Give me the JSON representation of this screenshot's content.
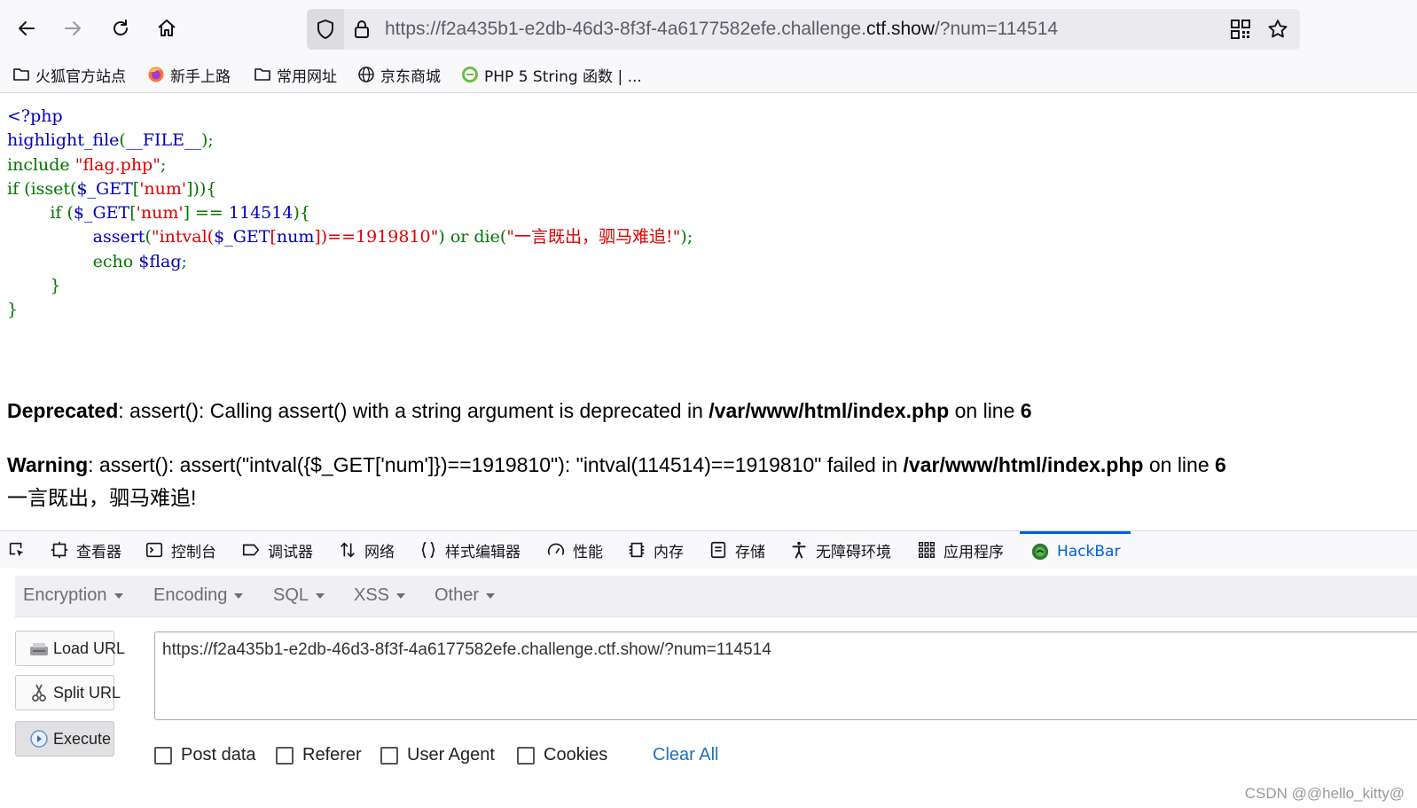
{
  "browser": {
    "url_prefix": "https://f2a435b1-e2db-46d3-8f3f-4a6177582efe.challenge.",
    "url_domain": "ctf.show",
    "url_suffix": "/?num=114514"
  },
  "bookmarks": [
    {
      "label": "火狐官方站点",
      "icon": "folder-icon"
    },
    {
      "label": "新手上路",
      "icon": "firefox-icon"
    },
    {
      "label": "常用网址",
      "icon": "folder-icon"
    },
    {
      "label": "京东商城",
      "icon": "globe-icon"
    },
    {
      "label": "PHP 5 String 函数 | ...",
      "icon": "php-site-icon"
    }
  ],
  "source": {
    "lines": [
      [
        {
          "t": "<?php",
          "c": "blue"
        }
      ],
      [
        {
          "t": "highlight_file",
          "c": "blue"
        },
        {
          "t": "(",
          "c": "green"
        },
        {
          "t": "__FILE__",
          "c": "blue"
        },
        {
          "t": ");",
          "c": "green"
        }
      ],
      [
        {
          "t": "include ",
          "c": "green"
        },
        {
          "t": "\"flag.php\"",
          "c": "red"
        },
        {
          "t": ";",
          "c": "green"
        }
      ],
      [
        {
          "t": "if ",
          "c": "green"
        },
        {
          "t": "(isset(",
          "c": "green"
        },
        {
          "t": "$_GET",
          "c": "blue"
        },
        {
          "t": "[",
          "c": "green"
        },
        {
          "t": "'num'",
          "c": "red"
        },
        {
          "t": "])){",
          "c": "green"
        }
      ],
      [
        {
          "t": "        if ",
          "c": "green"
        },
        {
          "t": "(",
          "c": "green"
        },
        {
          "t": "$_GET",
          "c": "blue"
        },
        {
          "t": "[",
          "c": "green"
        },
        {
          "t": "'num'",
          "c": "red"
        },
        {
          "t": "] ",
          "c": "green"
        },
        {
          "t": "== ",
          "c": "green"
        },
        {
          "t": "114514",
          "c": "blue"
        },
        {
          "t": "){",
          "c": "green"
        }
      ],
      [
        {
          "t": "                assert",
          "c": "blue"
        },
        {
          "t": "(",
          "c": "green"
        },
        {
          "t": "\"intval(",
          "c": "red"
        },
        {
          "t": "$_GET",
          "c": "blue"
        },
        {
          "t": "[",
          "c": "red"
        },
        {
          "t": "num",
          "c": "blue"
        },
        {
          "t": "])==1919810\"",
          "c": "red"
        },
        {
          "t": ") ",
          "c": "green"
        },
        {
          "t": "or ",
          "c": "green"
        },
        {
          "t": "die",
          "c": "green"
        },
        {
          "t": "(",
          "c": "green"
        },
        {
          "t": "\"一言既出，驷马难追!\"",
          "c": "red"
        },
        {
          "t": ");",
          "c": "green"
        }
      ],
      [
        {
          "t": "                echo ",
          "c": "green"
        },
        {
          "t": "$flag",
          "c": "blue"
        },
        {
          "t": ";",
          "c": "green"
        }
      ],
      [
        {
          "t": "        }",
          "c": "green"
        }
      ],
      [
        {
          "t": "}",
          "c": "green"
        }
      ]
    ]
  },
  "messages": {
    "deprecated": {
      "label": "Deprecated",
      "text": ": assert(): Calling assert() with a string argument is deprecated in ",
      "file": "/var/www/html/index.php",
      "on_line": " on line ",
      "line": "6"
    },
    "warning": {
      "label": "Warning",
      "text": ": assert(): assert(\"intval({$_GET['num']})==1919810\"): \"intval(114514)==1919810\" failed in ",
      "file": "/var/www/html/index.php",
      "on_line": " on line ",
      "line": "6"
    },
    "die_output": "一言既出，驷马难追!"
  },
  "devtools": {
    "tabs": [
      "查看器",
      "控制台",
      "调试器",
      "网络",
      "样式编辑器",
      "性能",
      "内存",
      "存储",
      "无障碍环境",
      "应用程序",
      "HackBar"
    ],
    "active_tab": "HackBar",
    "accent": "#0060df"
  },
  "hackbar": {
    "menus": [
      "Encryption",
      "Encoding",
      "SQL",
      "XSS",
      "Other"
    ],
    "buttons": {
      "load": "Load URL",
      "split": "Split URL",
      "execute": "Execute"
    },
    "url_value": "https://f2a435b1-e2db-46d3-8f3f-4a6177582efe.challenge.ctf.show/?num=114514",
    "options": [
      "Post data",
      "Referer",
      "User Agent",
      "Cookies"
    ],
    "clear_all": "Clear All"
  },
  "watermark": "CSDN @@hello_kitty@"
}
